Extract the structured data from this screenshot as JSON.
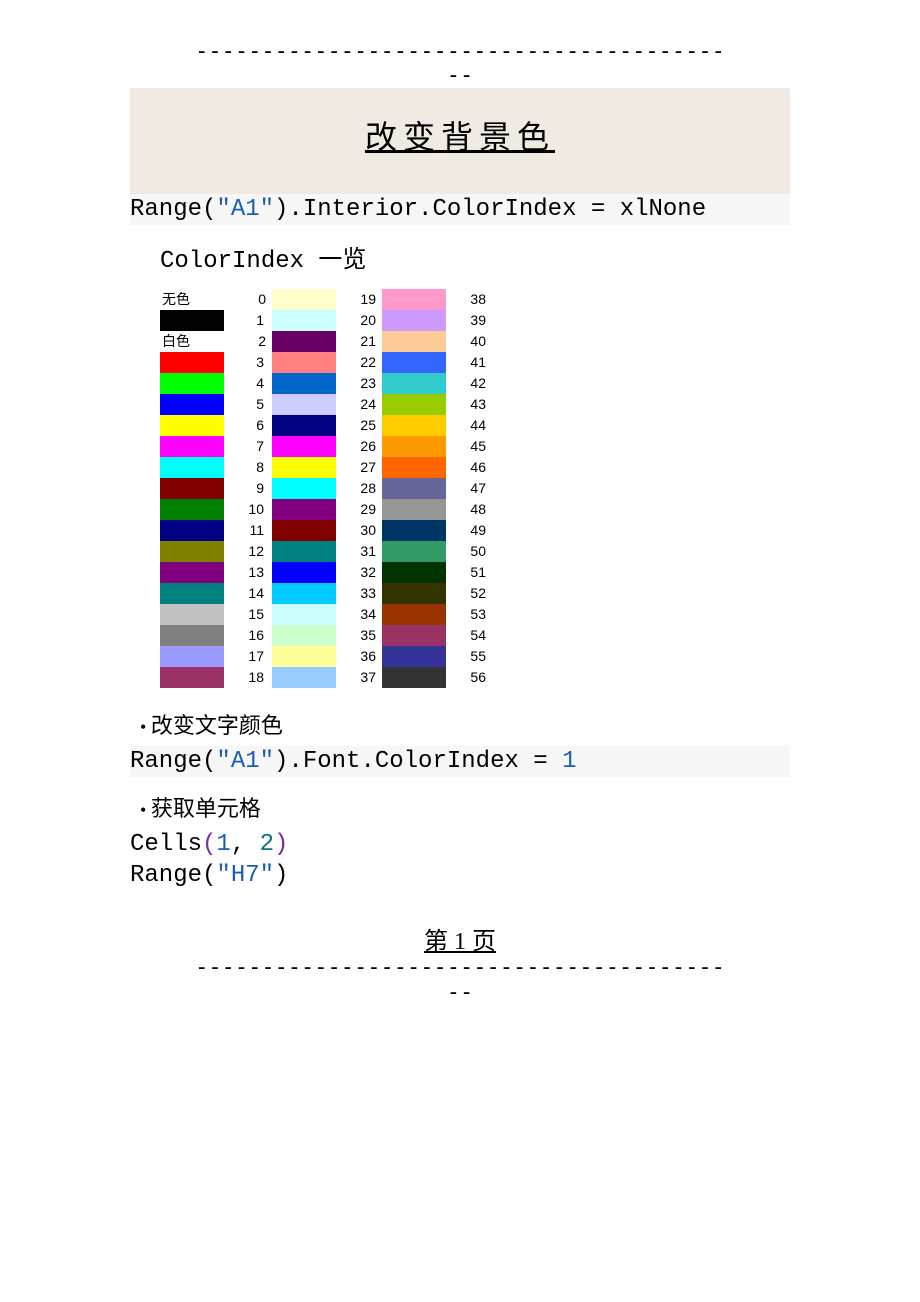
{
  "rule_top": "----------------------------------------\n--",
  "rule_bottom": "----------------------------------------\n--",
  "title": "改变背景色",
  "code1": {
    "prefix": "Range(",
    "arg": "\"A1\"",
    "suffix": ").Interior.ColorIndex = xlNone"
  },
  "section_label": "ColorIndex 一览",
  "chart_data": {
    "type": "table",
    "title": "ColorIndex 一览",
    "rows": [
      {
        "index": 0,
        "label": "无色",
        "hex": null,
        "col": 0
      },
      {
        "index": 1,
        "hex": "#000000",
        "col": 0
      },
      {
        "index": 2,
        "label": "白色",
        "hex": "#ffffff",
        "col": 0
      },
      {
        "index": 3,
        "hex": "#ff0000",
        "col": 0
      },
      {
        "index": 4,
        "hex": "#00ff00",
        "col": 0
      },
      {
        "index": 5,
        "hex": "#0000ff",
        "col": 0
      },
      {
        "index": 6,
        "hex": "#ffff00",
        "col": 0
      },
      {
        "index": 7,
        "hex": "#ff00ff",
        "col": 0
      },
      {
        "index": 8,
        "hex": "#00ffff",
        "col": 0
      },
      {
        "index": 9,
        "hex": "#800000",
        "col": 0
      },
      {
        "index": 10,
        "hex": "#008000",
        "col": 0
      },
      {
        "index": 11,
        "hex": "#000080",
        "col": 0
      },
      {
        "index": 12,
        "hex": "#808000",
        "col": 0
      },
      {
        "index": 13,
        "hex": "#800080",
        "col": 0
      },
      {
        "index": 14,
        "hex": "#008080",
        "col": 0
      },
      {
        "index": 15,
        "hex": "#c0c0c0",
        "col": 0
      },
      {
        "index": 16,
        "hex": "#808080",
        "col": 0
      },
      {
        "index": 17,
        "hex": "#9999ff",
        "col": 0
      },
      {
        "index": 18,
        "hex": "#993366",
        "col": 0
      },
      {
        "index": 19,
        "hex": "#ffffcc",
        "col": 1
      },
      {
        "index": 20,
        "hex": "#ccffff",
        "col": 1
      },
      {
        "index": 21,
        "hex": "#660066",
        "col": 1
      },
      {
        "index": 22,
        "hex": "#ff8080",
        "col": 1
      },
      {
        "index": 23,
        "hex": "#0066cc",
        "col": 1
      },
      {
        "index": 24,
        "hex": "#ccccff",
        "col": 1
      },
      {
        "index": 25,
        "hex": "#000080",
        "col": 1
      },
      {
        "index": 26,
        "hex": "#ff00ff",
        "col": 1
      },
      {
        "index": 27,
        "hex": "#ffff00",
        "col": 1
      },
      {
        "index": 28,
        "hex": "#00ffff",
        "col": 1
      },
      {
        "index": 29,
        "hex": "#800080",
        "col": 1
      },
      {
        "index": 30,
        "hex": "#800000",
        "col": 1
      },
      {
        "index": 31,
        "hex": "#008080",
        "col": 1
      },
      {
        "index": 32,
        "hex": "#0000ff",
        "col": 1
      },
      {
        "index": 33,
        "hex": "#00ccff",
        "col": 1
      },
      {
        "index": 34,
        "hex": "#ccffff",
        "col": 1
      },
      {
        "index": 35,
        "hex": "#ccffcc",
        "col": 1
      },
      {
        "index": 36,
        "hex": "#ffff99",
        "col": 1
      },
      {
        "index": 37,
        "hex": "#99ccff",
        "col": 1
      },
      {
        "index": 38,
        "hex": "#ff99cc",
        "col": 2
      },
      {
        "index": 39,
        "hex": "#cc99ff",
        "col": 2
      },
      {
        "index": 40,
        "hex": "#ffcc99",
        "col": 2
      },
      {
        "index": 41,
        "hex": "#3366ff",
        "col": 2
      },
      {
        "index": 42,
        "hex": "#33cccc",
        "col": 2
      },
      {
        "index": 43,
        "hex": "#99cc00",
        "col": 2
      },
      {
        "index": 44,
        "hex": "#ffcc00",
        "col": 2
      },
      {
        "index": 45,
        "hex": "#ff9900",
        "col": 2
      },
      {
        "index": 46,
        "hex": "#ff6600",
        "col": 2
      },
      {
        "index": 47,
        "hex": "#666699",
        "col": 2
      },
      {
        "index": 48,
        "hex": "#969696",
        "col": 2
      },
      {
        "index": 49,
        "hex": "#003366",
        "col": 2
      },
      {
        "index": 50,
        "hex": "#339966",
        "col": 2
      },
      {
        "index": 51,
        "hex": "#003300",
        "col": 2
      },
      {
        "index": 52,
        "hex": "#333300",
        "col": 2
      },
      {
        "index": 53,
        "hex": "#993300",
        "col": 2
      },
      {
        "index": 54,
        "hex": "#993366",
        "col": 2
      },
      {
        "index": 55,
        "hex": "#333399",
        "col": 2
      },
      {
        "index": 56,
        "hex": "#333333",
        "col": 2
      }
    ]
  },
  "bullets": {
    "b1": "改变文字颜色",
    "b2": "获取单元格"
  },
  "code2": {
    "prefix": "Range(",
    "arg": "\"A1\"",
    "mid": ").Font.ColorIndex = ",
    "val": "1"
  },
  "code3": {
    "fn": "Cells",
    "open": "(",
    "a": "1",
    "comma": ", ",
    "b": "2",
    "close": ")"
  },
  "code4": {
    "prefix": "Range(",
    "arg": "\"H7\"",
    "suffix": ")"
  },
  "footer": "第 1 页"
}
